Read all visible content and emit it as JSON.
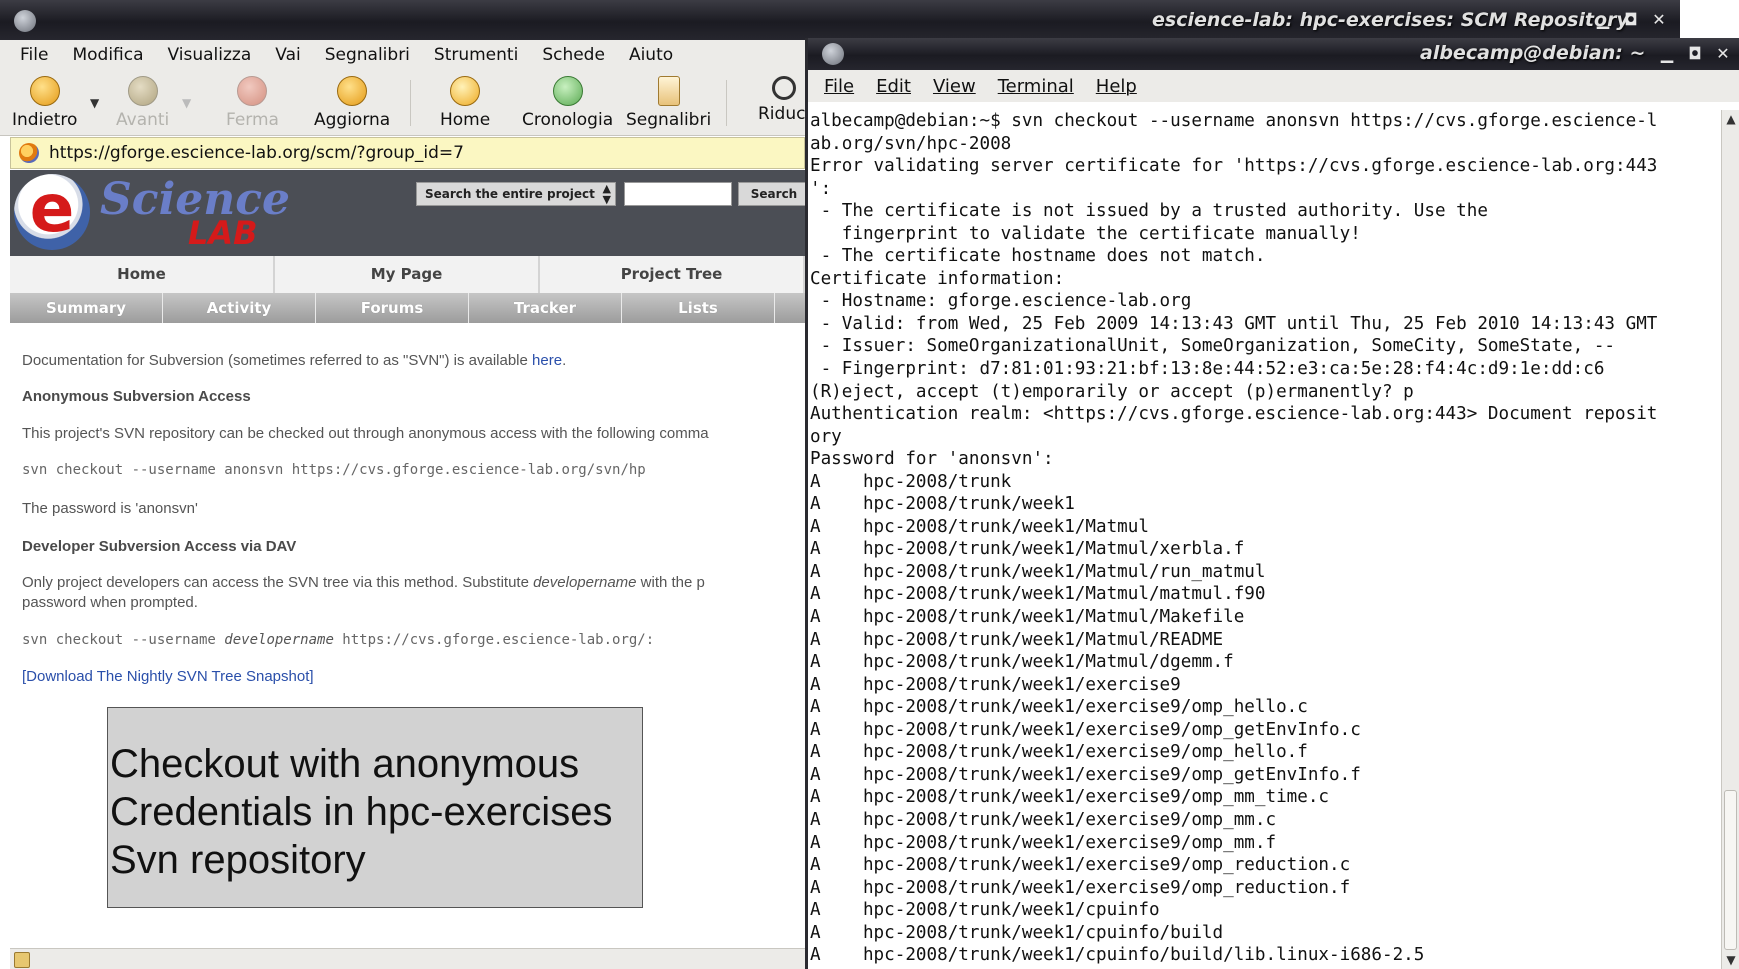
{
  "browser": {
    "window_title": "escience-lab: hpc-exercises: SCM Repository",
    "menu": [
      "File",
      "Modifica",
      "Visualizza",
      "Vai",
      "Segnalibri",
      "Strumenti",
      "Schede",
      "Aiuto"
    ],
    "toolbar": {
      "back": "Indietro",
      "forward": "Avanti",
      "stop": "Ferma",
      "reload": "Aggiorna",
      "home": "Home",
      "history": "Cronologia",
      "bookmarks": "Segnalibri",
      "zoom": "Riduci"
    },
    "url": "https://gforge.escience-lab.org/scm/?group_id=7",
    "site": {
      "logo_letter": "e",
      "logo_word": "Science",
      "logo_sub": "LAB",
      "search_scope": "Search the entire project",
      "search_button": "Search",
      "tabs": [
        "Home",
        "My Page",
        "Project Tree"
      ],
      "subtabs": [
        "Summary",
        "Activity",
        "Forums",
        "Tracker",
        "Lists"
      ]
    },
    "content": {
      "doc_text": "Documentation for Subversion (sometimes referred to as \"SVN\") is available ",
      "doc_link": "here",
      "doc_end": ".",
      "anon_heading": "Anonymous Subversion Access",
      "anon_text": "This project's SVN repository can be checked out through anonymous access with the following comma",
      "anon_cmd": "svn checkout --username anonsvn https://cvs.gforge.escience-lab.org/svn/hp",
      "password_text": "The password is 'anonsvn'",
      "dev_heading": "Developer Subversion Access via DAV",
      "dev_text_1": "Only project developers can access the SVN tree via this method. Substitute ",
      "dev_text_italic": "developername",
      "dev_text_2": " with the p",
      "dev_text_line2": "password when prompted.",
      "dev_cmd_1": "svn checkout --username ",
      "dev_cmd_italic": "developername",
      "dev_cmd_2": " https://cvs.gforge.escience-lab.org/:",
      "download_link": "[Download The Nightly SVN Tree Snapshot]"
    },
    "caption_lines": [
      "Checkout with anonymous",
      "Credentials in hpc-exercises",
      "Svn repository"
    ]
  },
  "terminal": {
    "window_title": "albecamp@debian: ~",
    "menu": [
      "File",
      "Edit",
      "View",
      "Terminal",
      "Help"
    ],
    "lines": [
      "albecamp@debian:~$ svn checkout --username anonsvn https://cvs.gforge.escience-l",
      "ab.org/svn/hpc-2008",
      "Error validating server certificate for 'https://cvs.gforge.escience-lab.org:443",
      "':",
      " - The certificate is not issued by a trusted authority. Use the",
      "   fingerprint to validate the certificate manually!",
      " - The certificate hostname does not match.",
      "Certificate information:",
      " - Hostname: gforge.escience-lab.org",
      " - Valid: from Wed, 25 Feb 2009 14:13:43 GMT until Thu, 25 Feb 2010 14:13:43 GMT",
      " - Issuer: SomeOrganizationalUnit, SomeOrganization, SomeCity, SomeState, --",
      " - Fingerprint: d7:81:01:93:21:bf:13:8e:44:52:e3:ca:5e:28:f4:4c:d9:1e:dd:c6",
      "(R)eject, accept (t)emporarily or accept (p)ermanently? p",
      "Authentication realm: <https://cvs.gforge.escience-lab.org:443> Document reposit",
      "ory",
      "Password for 'anonsvn':",
      "A    hpc-2008/trunk",
      "A    hpc-2008/trunk/week1",
      "A    hpc-2008/trunk/week1/Matmul",
      "A    hpc-2008/trunk/week1/Matmul/xerbla.f",
      "A    hpc-2008/trunk/week1/Matmul/run_matmul",
      "A    hpc-2008/trunk/week1/Matmul/matmul.f90",
      "A    hpc-2008/trunk/week1/Matmul/Makefile",
      "A    hpc-2008/trunk/week1/Matmul/README",
      "A    hpc-2008/trunk/week1/Matmul/dgemm.f",
      "A    hpc-2008/trunk/week1/exercise9",
      "A    hpc-2008/trunk/week1/exercise9/omp_hello.c",
      "A    hpc-2008/trunk/week1/exercise9/omp_getEnvInfo.c",
      "A    hpc-2008/trunk/week1/exercise9/omp_hello.f",
      "A    hpc-2008/trunk/week1/exercise9/omp_getEnvInfo.f",
      "A    hpc-2008/trunk/week1/exercise9/omp_mm_time.c",
      "A    hpc-2008/trunk/week1/exercise9/omp_mm.c",
      "A    hpc-2008/trunk/week1/exercise9/omp_mm.f",
      "A    hpc-2008/trunk/week1/exercise9/omp_reduction.c",
      "A    hpc-2008/trunk/week1/exercise9/omp_reduction.f",
      "A    hpc-2008/trunk/week1/cpuinfo",
      "A    hpc-2008/trunk/week1/cpuinfo/build",
      "A    hpc-2008/trunk/week1/cpuinfo/build/lib.linux-i686-2.5"
    ]
  }
}
